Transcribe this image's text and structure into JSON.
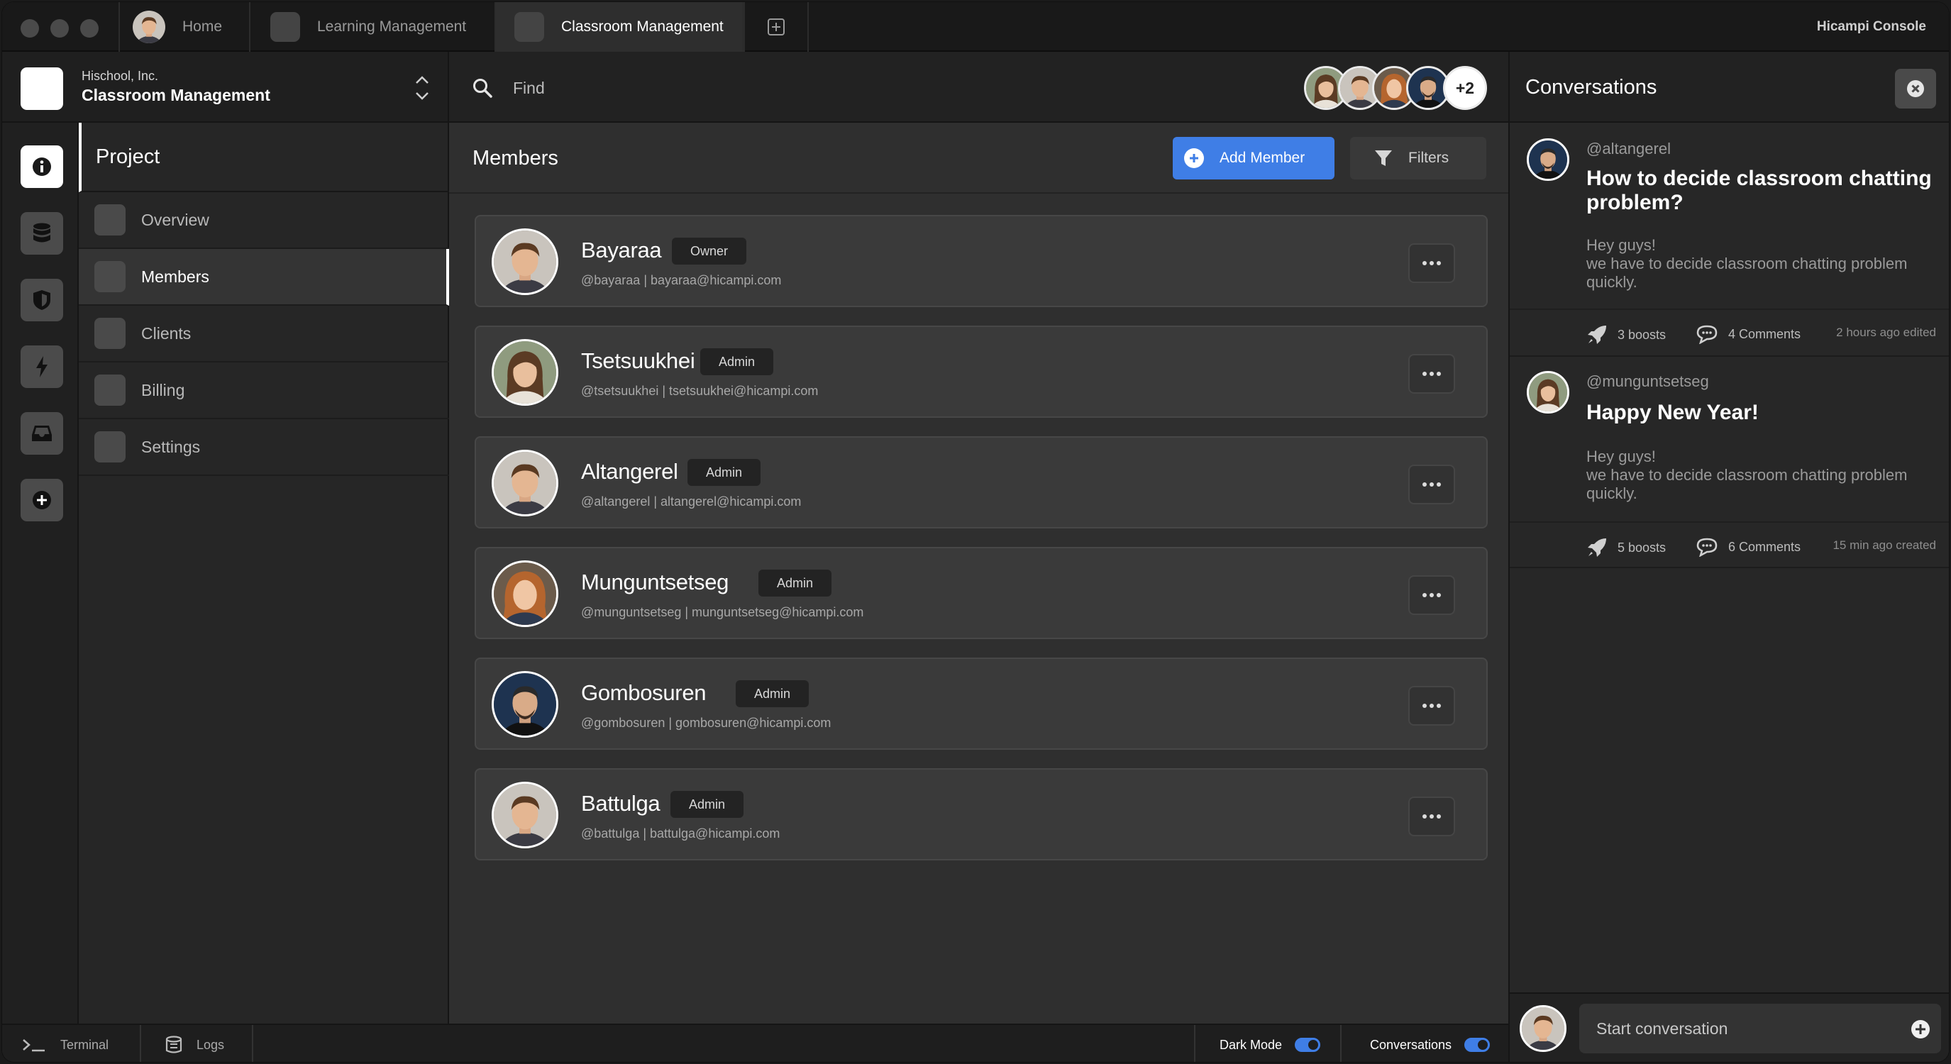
{
  "titlebar": {
    "tabs": [
      {
        "label": "Home"
      },
      {
        "label": "Learning Management"
      },
      {
        "label": "Classroom Management"
      }
    ],
    "console_title": "Hicampi Console"
  },
  "org": {
    "company": "Hischool, Inc.",
    "name": "Classroom Management"
  },
  "rail": {
    "icons": [
      "info-icon",
      "database-icon",
      "shield-icon",
      "lightning-icon",
      "inbox-icon",
      "add-icon"
    ]
  },
  "nav": {
    "title": "Project",
    "items": [
      {
        "label": "Overview"
      },
      {
        "label": "Members",
        "active": true
      },
      {
        "label": "Clients"
      },
      {
        "label": "Billing"
      },
      {
        "label": "Settings"
      }
    ]
  },
  "search": {
    "placeholder": "Find"
  },
  "avatar_stack": {
    "more": "+2"
  },
  "members": {
    "title": "Members",
    "add_label": "Add Member",
    "filter_label": "Filters",
    "list": [
      {
        "name": "Bayaraa",
        "role": "Owner",
        "meta": "@bayaraa | bayaraa@hicampi.com"
      },
      {
        "name": "Tsetsuukhei",
        "role": "Admin",
        "meta": "@tsetsuukhei | tsetsuukhei@hicampi.com"
      },
      {
        "name": "Altangerel",
        "role": "Admin",
        "meta": "@altangerel | altangerel@hicampi.com"
      },
      {
        "name": "Munguntsetseg",
        "role": "Admin",
        "meta": "@munguntsetseg | munguntsetseg@hicampi.com"
      },
      {
        "name": "Gombosuren",
        "role": "Admin",
        "meta": "@gombosuren | gombosuren@hicampi.com"
      },
      {
        "name": "Battulga",
        "role": "Admin",
        "meta": "@battulga | battulga@hicampi.com"
      }
    ]
  },
  "conversations": {
    "title": "Conversations",
    "posts": [
      {
        "handle": "@altangerel",
        "title": "How to decide classroom chatting problem?",
        "body_line1": "Hey guys!",
        "body_line2": "we have to decide classroom chatting problem quickly.",
        "boosts": "3 boosts",
        "comments": "4 Comments",
        "time": "2 hours ago edited"
      },
      {
        "handle": "@munguntsetseg",
        "title": "Happy New Year!",
        "body_line1": "Hey guys!",
        "body_line2": "we have to decide classroom chatting problem quickly.",
        "boosts": "5 boosts",
        "comments": "6 Comments",
        "time": "15 min ago created"
      }
    ],
    "start_placeholder": "Start conversation"
  },
  "statusbar": {
    "terminal": "Terminal",
    "logs": "Logs",
    "dark_mode": "Dark Mode",
    "conversations": "Conversations"
  },
  "colors": {
    "accent": "#3f7ee6",
    "background": "#2f2f2f",
    "card": "#3a3a3a"
  }
}
